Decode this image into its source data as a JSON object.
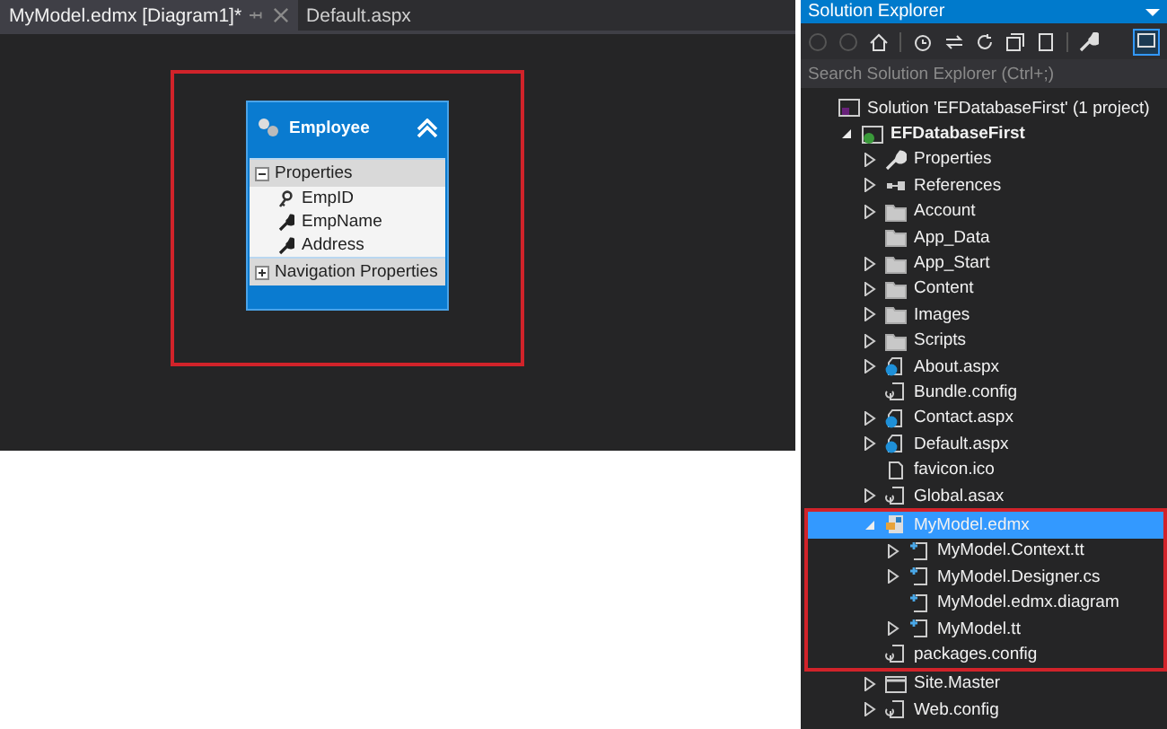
{
  "editor": {
    "tabs": [
      {
        "label": "MyModel.edmx [Diagram1]*",
        "selected": true
      },
      {
        "label": "Default.aspx",
        "selected": false
      }
    ],
    "diagram": {
      "highlighted": true,
      "entity": {
        "name": "Employee",
        "sections": [
          {
            "title": "Properties",
            "expanded": true,
            "items": [
              {
                "name": "EmpID",
                "kind": "key"
              },
              {
                "name": "EmpName",
                "kind": "property"
              },
              {
                "name": "Address",
                "kind": "property"
              }
            ]
          },
          {
            "title": "Navigation Properties",
            "expanded": false
          }
        ]
      }
    }
  },
  "solution_explorer": {
    "title": "Solution Explorer",
    "search": {
      "placeholder": "Search Solution Explorer (Ctrl+;)"
    },
    "tree": [
      {
        "label": "Solution 'EFDatabaseFirst' (1 project)",
        "kind": "solution",
        "selected": false,
        "children": [
          {
            "label": "EFDatabaseFirst",
            "kind": "project",
            "expanded": true,
            "selected": false,
            "children": [
              {
                "label": "Properties",
                "kind": "properties",
                "expanded": false,
                "selected": false,
                "highlighted": false
              },
              {
                "label": "References",
                "kind": "references",
                "expanded": false,
                "selected": false,
                "highlighted": false
              },
              {
                "label": "Account",
                "kind": "folder",
                "expanded": false,
                "selected": false,
                "highlighted": false
              },
              {
                "label": "App_Data",
                "kind": "folder",
                "selected": false,
                "highlighted": false
              },
              {
                "label": "App_Start",
                "kind": "folder",
                "expanded": false,
                "selected": false,
                "highlighted": false
              },
              {
                "label": "Content",
                "kind": "folder",
                "expanded": false,
                "selected": false,
                "highlighted": false
              },
              {
                "label": "Images",
                "kind": "folder",
                "expanded": false,
                "selected": false,
                "highlighted": false
              },
              {
                "label": "Scripts",
                "kind": "folder",
                "expanded": false,
                "selected": false,
                "highlighted": false
              },
              {
                "label": "About.aspx",
                "kind": "page",
                "expanded": false,
                "selected": false,
                "highlighted": false
              },
              {
                "label": "Bundle.config",
                "kind": "config",
                "selected": false,
                "highlighted": false
              },
              {
                "label": "Contact.aspx",
                "kind": "page",
                "expanded": false,
                "selected": false,
                "highlighted": false
              },
              {
                "label": "Default.aspx",
                "kind": "page",
                "expanded": false,
                "selected": false,
                "highlighted": false
              },
              {
                "label": "favicon.ico",
                "kind": "file",
                "selected": false,
                "highlighted": false
              },
              {
                "label": "Global.asax",
                "kind": "config",
                "expanded": false,
                "selected": false,
                "highlighted": false
              },
              {
                "label": "MyModel.edmx",
                "kind": "edmx",
                "expanded": true,
                "selected": true,
                "highlighted": true,
                "children": [
                  {
                    "label": "MyModel.Context.tt",
                    "kind": "template",
                    "expanded": false,
                    "selected": false
                  },
                  {
                    "label": "MyModel.Designer.cs",
                    "kind": "template",
                    "expanded": false,
                    "selected": false
                  },
                  {
                    "label": "MyModel.edmx.diagram",
                    "kind": "template",
                    "selected": false
                  },
                  {
                    "label": "MyModel.tt",
                    "kind": "template",
                    "expanded": false,
                    "selected": false
                  }
                ]
              },
              {
                "label": "packages.config",
                "kind": "config",
                "selected": false,
                "highlighted": true
              },
              {
                "label": "Site.Master",
                "kind": "master",
                "expanded": false,
                "selected": false,
                "highlighted": false
              },
              {
                "label": "Web.config",
                "kind": "config",
                "expanded": false,
                "selected": false,
                "highlighted": false
              }
            ]
          }
        ]
      }
    ]
  }
}
